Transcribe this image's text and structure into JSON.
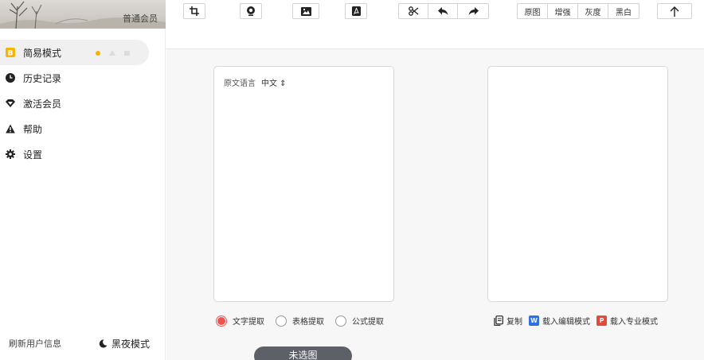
{
  "sidebar": {
    "member_label": "普通会员",
    "items": [
      {
        "label": "简易模式",
        "icon": "simple-mode-icon"
      },
      {
        "label": "历史记录",
        "icon": "clock-icon"
      },
      {
        "label": "激活会员",
        "icon": "diamond-icon"
      },
      {
        "label": "帮助",
        "icon": "warning-icon"
      },
      {
        "label": "设置",
        "icon": "gear-icon"
      }
    ],
    "refresh_label": "刷新用户信息",
    "night_label": "黑夜模式"
  },
  "toolbar": {
    "icons": [
      "crop-icon",
      "camera-icon",
      "image-icon",
      "pdf-icon",
      "scissors-icon",
      "undo-icon",
      "redo-icon",
      "upload-icon"
    ],
    "filters": [
      "原图",
      "增强",
      "灰度",
      "黑白"
    ]
  },
  "left_panel": {
    "lang_label": "原文语言",
    "lang_value": "中文 ⇕"
  },
  "extract_options": [
    {
      "label": "文字提取",
      "selected": true
    },
    {
      "label": "表格提取",
      "selected": false
    },
    {
      "label": "公式提取",
      "selected": false
    }
  ],
  "actions": {
    "copy": "复制",
    "load_edit": "载入编辑模式",
    "load_pro": "载入专业模式"
  },
  "no_selection_label": "未选图",
  "colors": {
    "accent_red": "#ef5350",
    "dot_yellow": "#f5b400",
    "word_blue": "#2f6fde",
    "ppt_red": "#e04b3c",
    "button_dark": "#5d6066"
  }
}
